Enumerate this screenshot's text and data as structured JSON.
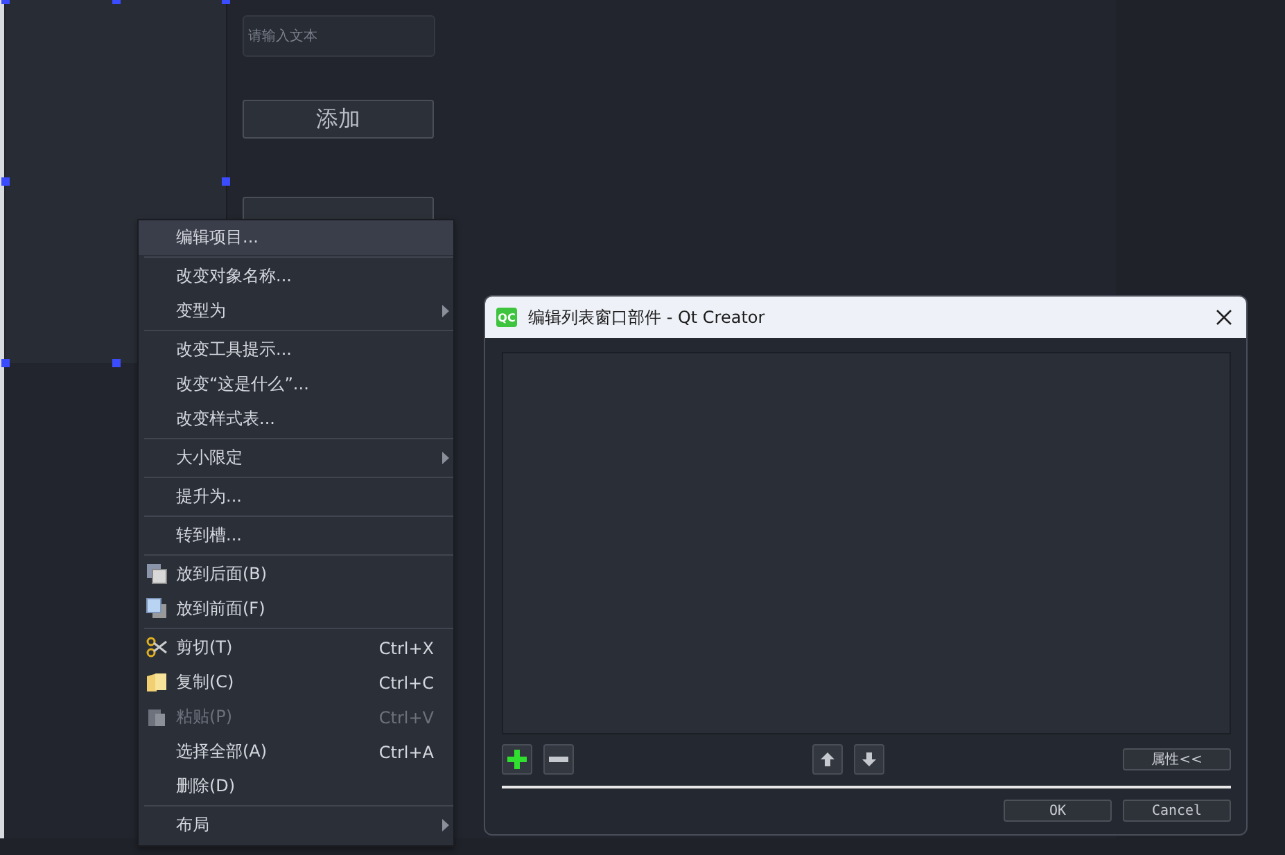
{
  "form": {
    "input": {
      "placeholder": "请输入文本"
    },
    "buttons": [
      "添加"
    ]
  },
  "context_menu": {
    "items": [
      {
        "kind": "text",
        "label": "编辑项目...",
        "selected": true,
        "disabled": false,
        "submenu": false
      },
      {
        "kind": "separator"
      },
      {
        "kind": "text",
        "label": "改变对象名称...",
        "selected": false,
        "disabled": false,
        "submenu": false
      },
      {
        "kind": "text",
        "label": "变型为",
        "selected": false,
        "disabled": false,
        "submenu": true
      },
      {
        "kind": "separator"
      },
      {
        "kind": "text",
        "label": "改变工具提示...",
        "selected": false,
        "disabled": false,
        "submenu": false
      },
      {
        "kind": "text",
        "label": "改变“这是什么”...",
        "selected": false,
        "disabled": false,
        "submenu": false
      },
      {
        "kind": "text",
        "label": "改变样式表...",
        "selected": false,
        "disabled": false,
        "submenu": false
      },
      {
        "kind": "separator"
      },
      {
        "kind": "text",
        "label": "大小限定",
        "selected": false,
        "disabled": false,
        "submenu": true
      },
      {
        "kind": "separator"
      },
      {
        "kind": "text",
        "label": "提升为...",
        "selected": false,
        "disabled": false,
        "submenu": false
      },
      {
        "kind": "separator"
      },
      {
        "kind": "text",
        "label": "转到槽...",
        "selected": false,
        "disabled": false,
        "submenu": false
      },
      {
        "kind": "separator"
      },
      {
        "kind": "back",
        "label": "放到后面(B)",
        "selected": false,
        "disabled": false,
        "submenu": false
      },
      {
        "kind": "front",
        "label": "放到前面(F)",
        "selected": false,
        "disabled": false,
        "submenu": false
      },
      {
        "kind": "separator"
      },
      {
        "kind": "cut",
        "label": "剪切(T)",
        "shortcut": "Ctrl+X",
        "selected": false,
        "disabled": false,
        "submenu": false
      },
      {
        "kind": "copy",
        "label": "复制(C)",
        "shortcut": "Ctrl+C",
        "selected": false,
        "disabled": false,
        "submenu": false
      },
      {
        "kind": "paste",
        "label": "粘贴(P)",
        "shortcut": "Ctrl+V",
        "selected": false,
        "disabled": true,
        "submenu": false
      },
      {
        "kind": "text",
        "label": "选择全部(A)",
        "shortcut": "Ctrl+A",
        "selected": false,
        "disabled": false,
        "submenu": false
      },
      {
        "kind": "text",
        "label": "删除(D)",
        "selected": false,
        "disabled": false,
        "submenu": false
      },
      {
        "kind": "separator"
      },
      {
        "kind": "text",
        "label": "布局",
        "selected": false,
        "disabled": false,
        "submenu": true
      }
    ]
  },
  "dialog": {
    "app_icon": "QC",
    "title": "编辑列表窗口部件 - Qt Creator",
    "properties_button": "属性<<",
    "buttons": [
      "OK",
      "Cancel"
    ]
  }
}
